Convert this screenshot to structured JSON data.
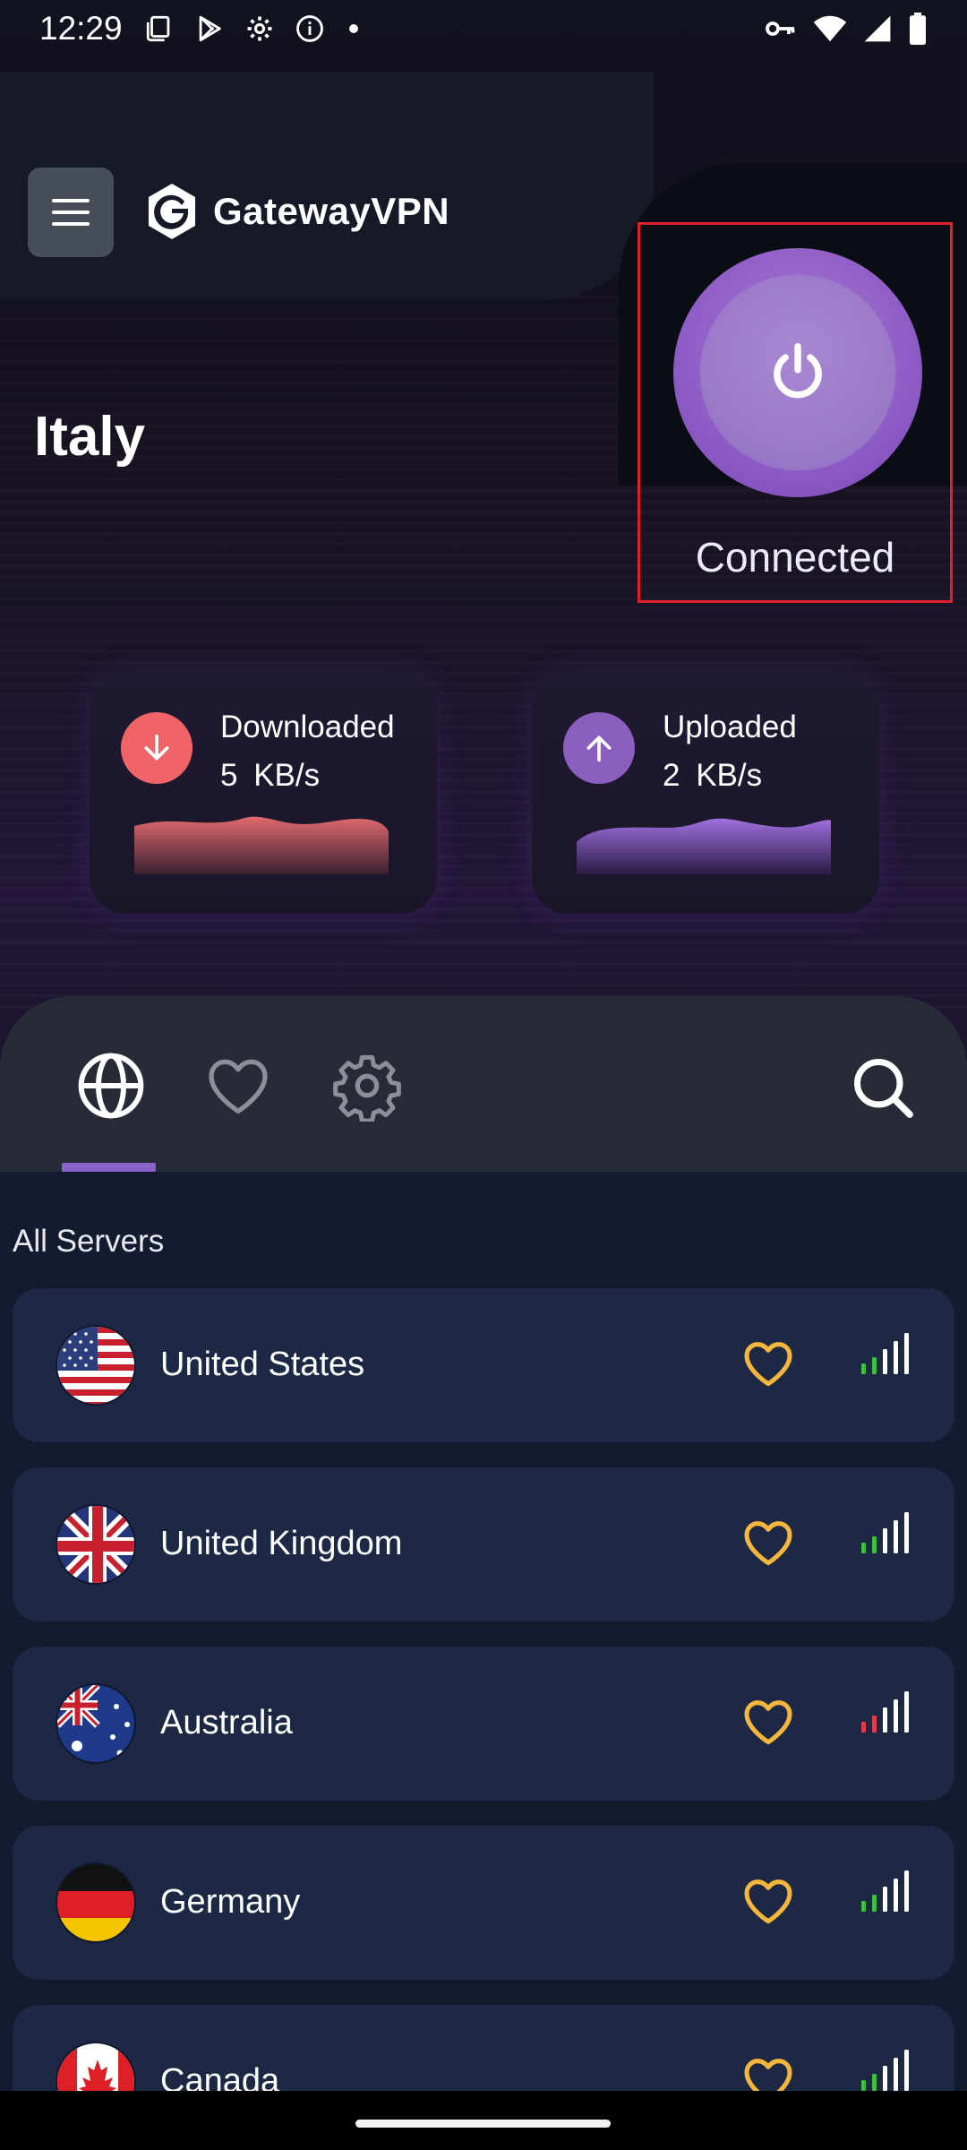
{
  "status_bar": {
    "time": "12:29",
    "left_icons": [
      "screen-icon",
      "play-store-icon",
      "settings-icon",
      "info-icon",
      "dot-icon"
    ],
    "right_icons": [
      "vpn-key-icon",
      "wifi-icon",
      "cell-signal-icon",
      "battery-icon"
    ]
  },
  "header": {
    "brand_name": "GatewayVPN",
    "menu_icon": "hamburger-menu-icon"
  },
  "connection": {
    "country": "Italy",
    "status": "Connected",
    "button_icon": "power-icon",
    "accent_color": "#8d5cc6"
  },
  "stats": {
    "downloaded": {
      "label": "Downloaded",
      "value": "5  KB/s",
      "color": "#f06468",
      "icon": "arrow-down-icon"
    },
    "uploaded": {
      "label": "Uploaded",
      "value": "2  KB/s",
      "color": "#8a5fc0",
      "icon": "arrow-up-icon"
    }
  },
  "tabs": [
    {
      "name": "globe-icon",
      "active": true
    },
    {
      "name": "heart-icon",
      "active": false
    },
    {
      "name": "gear-icon",
      "active": false
    }
  ],
  "search_icon": "search-icon",
  "servers": {
    "section_label": "All Servers",
    "items": [
      {
        "name": "United States",
        "flag": "us-flag",
        "signal_color": "#3fbf3f"
      },
      {
        "name": "United Kingdom",
        "flag": "uk-flag",
        "signal_color": "#3fbf3f"
      },
      {
        "name": "Australia",
        "flag": "au-flag",
        "signal_color": "#e63950"
      },
      {
        "name": "Germany",
        "flag": "de-flag",
        "signal_color": "#3fbf3f"
      },
      {
        "name": "Canada",
        "flag": "ca-flag",
        "signal_color": "#3fbf3f"
      }
    ]
  }
}
